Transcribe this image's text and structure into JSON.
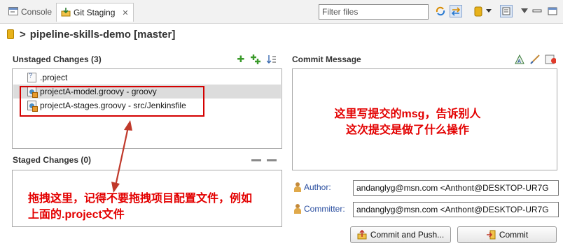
{
  "tabs": [
    {
      "label": "Console",
      "active": false
    },
    {
      "label": "Git Staging",
      "active": true
    }
  ],
  "toolbar": {
    "filter_placeholder": "Filter files"
  },
  "repository": {
    "label": "pipeline-skills-demo [master]"
  },
  "unstaged": {
    "title": "Unstaged Changes (3)",
    "files": [
      {
        "name": ".project",
        "icon": "file-question-icon",
        "selected": false
      },
      {
        "name": "projectA-model.groovy - groovy",
        "icon": "groovy-file-icon",
        "selected": true
      },
      {
        "name": "projectA-stages.groovy - src/Jenkinsfile",
        "icon": "groovy-file-icon",
        "selected": false
      }
    ]
  },
  "staged": {
    "title": "Staged Changes (0)",
    "files": []
  },
  "commit": {
    "title": "Commit Message",
    "message": "",
    "author_label": "Author:",
    "author_value": "andanglyg@msn.com <Anthont@DESKTOP-UR7G",
    "committer_label": "Committer:",
    "committer_value": "andanglyg@msn.com <Anthont@DESKTOP-UR7G",
    "commit_push_label": "Commit and Push...",
    "commit_label": "Commit"
  },
  "annotations": {
    "drag_note": "拖拽这里，记得不要拖拽项目配置文件，例如上面的.project文件",
    "message_note": "这里写提交的msg，告诉别人这次提交是做了什么操作",
    "color": "#e30000"
  }
}
